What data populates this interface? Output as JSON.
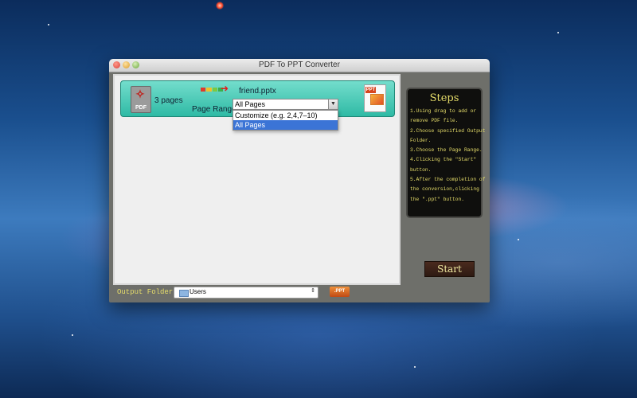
{
  "window": {
    "title": "PDF To PPT Converter"
  },
  "file_row": {
    "source_icon_label": "PDF",
    "page_count": "3 pages",
    "target_filename": "friend.pptx",
    "page_range_label": "Page Range:",
    "page_range_value": "All Pages",
    "target_icon_label": "PPT"
  },
  "page_range_options": [
    {
      "label": "Customize (e.g. 2,4,7–10)",
      "selected": false
    },
    {
      "label": "All Pages",
      "selected": true
    }
  ],
  "steps": {
    "title": "Steps",
    "lines": [
      "1.Using drag to add or",
      "  remove PDF file.",
      "2.Choose specified Output",
      "  Folder.",
      "3.Choose the Page Range.",
      "4.Clicking the \"Start\"",
      "  button.",
      "5.After the completion of",
      "  the conversion,clicking",
      "  the \".ppt\" button."
    ]
  },
  "start_button": "Start",
  "output": {
    "label": "Output Folder",
    "folder": "Users",
    "ppt_button": ".PPT"
  },
  "colors": {
    "file_row_bg": "#2fbaa5",
    "steps_text": "#e6dd6a",
    "dropdown_selected": "#3b74d6",
    "progress_bar": [
      "#e03a2a",
      "#f0c02a",
      "#7ac943",
      "#3bb04a"
    ]
  },
  "icons": {
    "pdf": "pdf-file-icon",
    "arrow": "arrow-right-icon",
    "ppt": "ppt-file-icon",
    "folder": "folder-icon",
    "chevron": "chevron-down-icon"
  }
}
